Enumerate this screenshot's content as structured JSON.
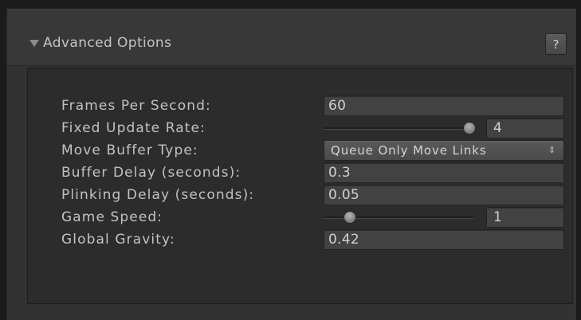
{
  "section": {
    "title": "Advanced Options",
    "expanded": true,
    "help_label": "?"
  },
  "fields": [
    {
      "label": "Frames Per Second:",
      "type": "text",
      "value": "60"
    },
    {
      "label": "Fixed Update Rate:",
      "type": "slider",
      "value": "4",
      "slider_position": 0.97
    },
    {
      "label": "Move Buffer Type:",
      "type": "dropdown",
      "value": "Queue Only Move Links"
    },
    {
      "label": "Buffer Delay (seconds):",
      "type": "text",
      "value": "0.3"
    },
    {
      "label": "Plinking Delay (seconds):",
      "type": "text",
      "value": "0.05"
    },
    {
      "label": "Game Speed:",
      "type": "slider",
      "value": "1",
      "slider_position": 0.14
    },
    {
      "label": "Global Gravity:",
      "type": "text",
      "value": "0.42"
    }
  ],
  "icons": {
    "foldout": "triangle-down-icon",
    "dropdown": "up-down-arrows-icon",
    "help": "help-icon"
  },
  "colors": {
    "background": "#1b1b1b",
    "window": "#323232",
    "panel": "#2c2c2c",
    "field": "#424242",
    "text": "#c2c2c2"
  }
}
